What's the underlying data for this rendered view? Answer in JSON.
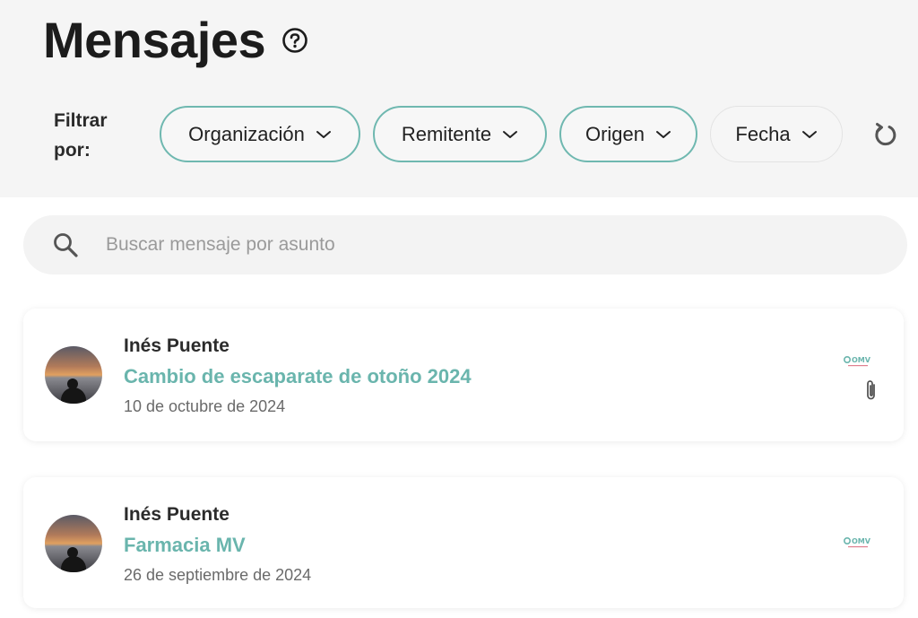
{
  "page": {
    "title": "Mensajes"
  },
  "filters": {
    "label": "Filtrar por:",
    "chips": [
      {
        "label": "Organización"
      },
      {
        "label": "Remitente"
      },
      {
        "label": "Origen"
      },
      {
        "label": "Fecha"
      }
    ]
  },
  "search": {
    "placeholder": "Buscar mensaje por asunto",
    "value": ""
  },
  "messages": [
    {
      "sender": "Inés Puente",
      "subject": "Cambio de escaparate de otoño 2024",
      "date": "10 de octubre de 2024",
      "org_logo": "OMV",
      "has_attachment": true
    },
    {
      "sender": "Inés Puente",
      "subject": "Farmacia MV",
      "date": "26 de septiembre de 2024",
      "org_logo": "OMV",
      "has_attachment": false
    }
  ],
  "colors": {
    "accent": "#6ab5ad",
    "chip_border": "#6fb8b0",
    "header_bg": "#f5f5f5"
  },
  "icons": [
    "help-icon",
    "chevron-down-icon",
    "reset-icon",
    "search-icon",
    "paperclip-icon"
  ]
}
